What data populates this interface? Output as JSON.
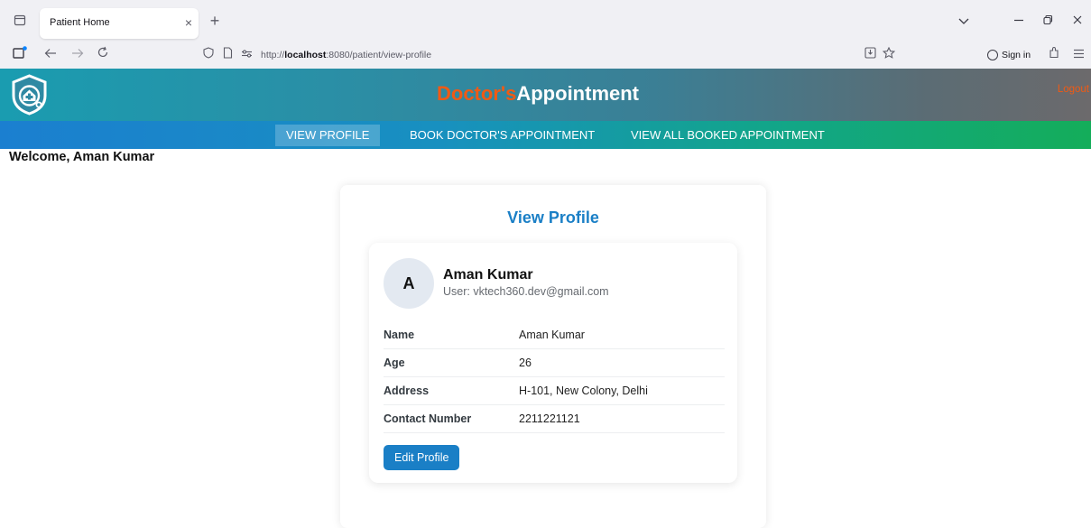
{
  "browser": {
    "tab_title": "Patient Home",
    "tab_close": "×",
    "new_tab": "+",
    "url_prefix": "http://",
    "url_host": "localhost",
    "url_path": ":8080/patient/view-profile",
    "sign_in": "Sign in"
  },
  "header": {
    "brand_part1": "Doctor's",
    "brand_part2": "Appointment",
    "logout": "Logout",
    "brand_color": "#f05a14"
  },
  "menu": {
    "items": [
      "VIEW PROFILE",
      "BOOK DOCTOR'S APPOINTMENT",
      "VIEW ALL BOOKED APPOINTMENT"
    ],
    "active": "VIEW PROFILE"
  },
  "welcome": "Welcome, Aman Kumar",
  "profile": {
    "title": "View Profile",
    "avatar_initial": "A",
    "name": "Aman Kumar",
    "user_email": "User: vktech360.dev@gmail.com",
    "fields": [
      {
        "label": "Name",
        "value": "Aman Kumar"
      },
      {
        "label": "Age",
        "value": "26"
      },
      {
        "label": "Address",
        "value": "H-101, New Colony, Delhi"
      },
      {
        "label": "Contact Number",
        "value": "2211221121"
      }
    ],
    "edit_button": "Edit Profile",
    "accent_color": "#1a7fc6"
  }
}
